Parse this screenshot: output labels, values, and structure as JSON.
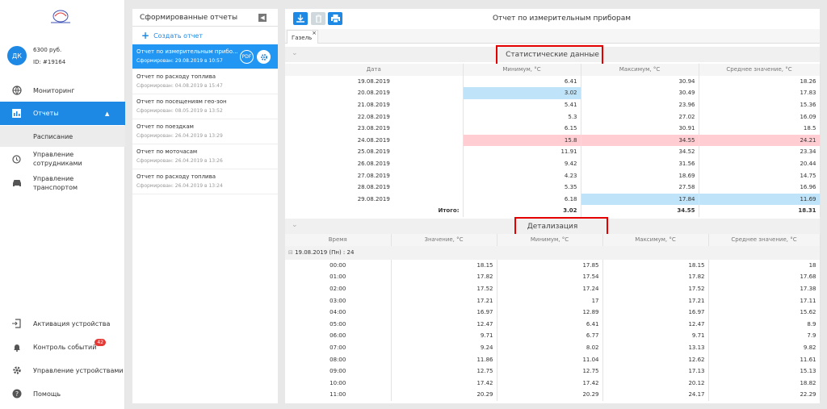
{
  "sidebar": {
    "avatar": "ДК",
    "balance": "6300 руб.",
    "user_id": "ID: #19164",
    "nav": {
      "monitoring": "Мониторинг",
      "reports": "Отчеты",
      "schedule": "Расписание",
      "employees_1": "Управление",
      "employees_2": "сотрудниками",
      "transport_1": "Управление",
      "transport_2": "транспортом"
    },
    "bottom": {
      "activation": "Активация устройства",
      "events": "Контроль событий",
      "events_badge": "42",
      "devices": "Управление устройствами",
      "help": "Помощь"
    }
  },
  "reports": {
    "title": "Сформированные отчеты",
    "create": "Создать отчет",
    "pdf": "PDF",
    "items": [
      {
        "title": "Отчет по измерительным прибо...",
        "date": "Сформирован: 29.08.2019 в 10:57"
      },
      {
        "title": "Отчет по расходу топлива",
        "date": "Сформирован: 04.08.2019 в 15:47"
      },
      {
        "title": "Отчет по посещениям гео-зон",
        "date": "Сформирован: 08.05.2019 в 13:52"
      },
      {
        "title": "Отчет по поездкам",
        "date": "Сформирован: 26.04.2019 в 13:29"
      },
      {
        "title": "Отчет по моточасам",
        "date": "Сформирован: 26.04.2019 в 13:26"
      },
      {
        "title": "Отчет по расходу топлива",
        "date": "Сформирован: 26.04.2019 в 13:24"
      }
    ]
  },
  "main": {
    "title": "Отчет по измерительным приборам",
    "tab": "Газель",
    "stats": {
      "heading": "Статистические данные",
      "columns": [
        "Дата",
        "Минимум, °C",
        "Максимум, °C",
        "Среднее значение, °C"
      ],
      "rows": [
        [
          "19.08.2019",
          "6.41",
          "30.94",
          "18.26"
        ],
        [
          "20.08.2019",
          "3.02",
          "30.49",
          "17.83"
        ],
        [
          "21.08.2019",
          "5.41",
          "23.96",
          "15.36"
        ],
        [
          "22.08.2019",
          "5.3",
          "27.02",
          "16.09"
        ],
        [
          "23.08.2019",
          "6.15",
          "30.91",
          "18.5"
        ],
        [
          "24.08.2019",
          "15.8",
          "34.55",
          "24.21"
        ],
        [
          "25.08.2019",
          "11.91",
          "34.52",
          "23.34"
        ],
        [
          "26.08.2019",
          "9.42",
          "31.56",
          "20.44"
        ],
        [
          "27.08.2019",
          "4.23",
          "18.69",
          "14.75"
        ],
        [
          "28.08.2019",
          "5.35",
          "27.58",
          "16.96"
        ],
        [
          "29.08.2019",
          "6.18",
          "17.84",
          "11.69"
        ]
      ],
      "total": [
        "Итого:",
        "3.02",
        "34.55",
        "18.31"
      ]
    },
    "detail": {
      "heading": "Детализация",
      "columns": [
        "Время",
        "Значение, °C",
        "Минимум, °C",
        "Максимум, °C",
        "Среднее значение, °C"
      ],
      "group": "19.08.2019 (Пн) : 24",
      "rows": [
        [
          "00:00",
          "18.15",
          "17.85",
          "18.15",
          "18"
        ],
        [
          "01:00",
          "17.82",
          "17.54",
          "17.82",
          "17.68"
        ],
        [
          "02:00",
          "17.52",
          "17.24",
          "17.52",
          "17.38"
        ],
        [
          "03:00",
          "17.21",
          "17",
          "17.21",
          "17.11"
        ],
        [
          "04:00",
          "16.97",
          "12.89",
          "16.97",
          "15.62"
        ],
        [
          "05:00",
          "12.47",
          "6.41",
          "12.47",
          "8.9"
        ],
        [
          "06:00",
          "9.71",
          "6.77",
          "9.71",
          "7.9"
        ],
        [
          "07:00",
          "9.24",
          "8.02",
          "13.13",
          "9.82"
        ],
        [
          "08:00",
          "11.86",
          "11.04",
          "12.62",
          "11.61"
        ],
        [
          "09:00",
          "12.75",
          "12.75",
          "17.13",
          "15.13"
        ],
        [
          "10:00",
          "17.42",
          "17.42",
          "20.12",
          "18.82"
        ],
        [
          "11:00",
          "20.29",
          "20.29",
          "24.17",
          "22.29"
        ]
      ]
    }
  }
}
